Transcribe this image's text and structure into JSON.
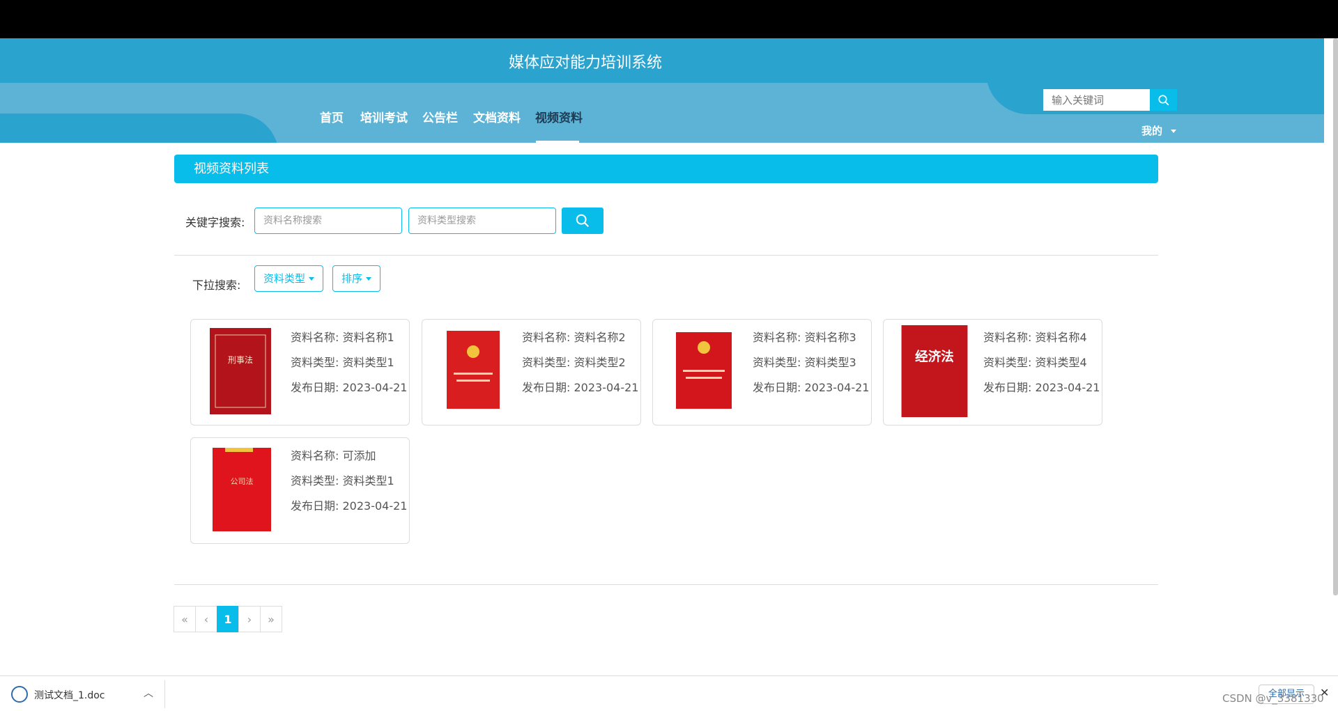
{
  "site": {
    "title": "媒体应对能力培训系统"
  },
  "nav": {
    "items": [
      {
        "label": "首页"
      },
      {
        "label": "培训考试"
      },
      {
        "label": "公告栏"
      },
      {
        "label": "文档资料"
      },
      {
        "label": "视频资料"
      }
    ],
    "active": "视频资料"
  },
  "header_search": {
    "placeholder": "输入关键词"
  },
  "user_menu": {
    "label": "我的"
  },
  "section": {
    "title": "视频资料列表"
  },
  "search": {
    "label": "关键字搜索:",
    "name_placeholder": "资料名称搜索",
    "type_placeholder": "资料类型搜索"
  },
  "filter": {
    "label": "下拉搜索:",
    "type_button": "资料类型",
    "sort_button": "排序"
  },
  "field_labels": {
    "name": "资料名称:",
    "type": "资料类型:",
    "date": "发布日期:"
  },
  "cards": [
    {
      "name": "资料名称1",
      "type": "资料类型1",
      "date": "2023-04-21",
      "cover_color": "#b3141c",
      "cover_text": "刑事法"
    },
    {
      "name": "资料名称2",
      "type": "资料类型2",
      "date": "2023-04-21",
      "cover_color": "#d81e1e",
      "cover_text": ""
    },
    {
      "name": "资料名称3",
      "type": "资料类型3",
      "date": "2023-04-21",
      "cover_color": "#d2161b",
      "cover_text": ""
    },
    {
      "name": "资料名称4",
      "type": "资料类型4",
      "date": "2023-04-21",
      "cover_color": "#c3161c",
      "cover_text": "经济法"
    },
    {
      "name": "可添加",
      "type": "资料类型1",
      "date": "2023-04-21",
      "cover_color": "#e0141c",
      "cover_text": "公司法"
    }
  ],
  "pagination": {
    "first": "«",
    "prev": "‹",
    "current": "1",
    "next": "›",
    "last": "»"
  },
  "download_bar": {
    "file": "测试文档_1.doc",
    "show_all": "全部显示"
  },
  "watermark": "CSDN @v_3381330",
  "colors": {
    "header": "#2ba3cf",
    "nav": "#5cb3d6",
    "accent": "#09bdea"
  }
}
